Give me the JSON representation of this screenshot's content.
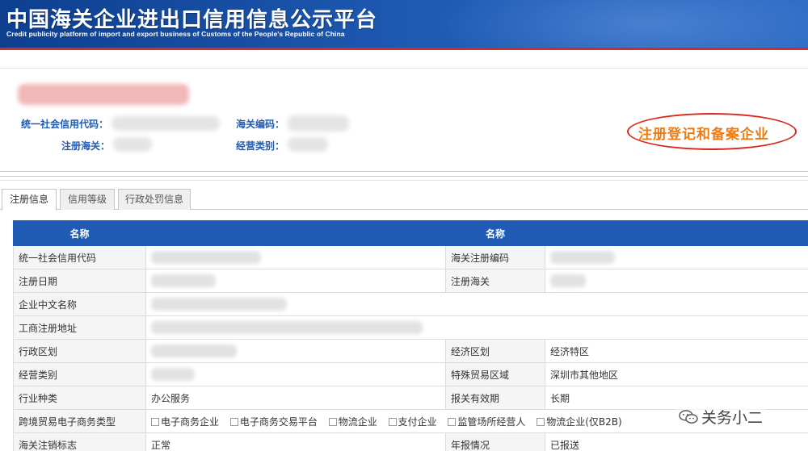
{
  "header": {
    "title": "中国海关企业进出口信用信息公示平台",
    "subtitle": "Credit publicity platform of import and export business of Customs of the People's Republic of China"
  },
  "company": {
    "labels": {
      "credit_code": "统一社会信用代码：",
      "customs_code": "海关编码：",
      "reg_customs": "注册海关：",
      "business_type": "经营类别："
    },
    "annotation": "注册登记和备案企业"
  },
  "tabs": [
    {
      "label": "注册信息",
      "active": true
    },
    {
      "label": "信用等级",
      "active": false
    },
    {
      "label": "行政处罚信息",
      "active": false
    }
  ],
  "table": {
    "headers": [
      "名称",
      "",
      "名称",
      ""
    ],
    "rows": {
      "r1": {
        "k1": "统一社会信用代码",
        "k2": "海关注册编码"
      },
      "r2": {
        "k1": "注册日期",
        "k2": "注册海关"
      },
      "r3": {
        "k1": "企业中文名称"
      },
      "r4": {
        "k1": "工商注册地址"
      },
      "r5": {
        "k1": "行政区划",
        "k2": "经济区划",
        "v2": "经济特区"
      },
      "r6": {
        "k1": "经营类别",
        "k2": "特殊贸易区域",
        "v2": "深圳市其他地区"
      },
      "r7": {
        "k1": "行业种类",
        "v1": "办公服务",
        "k2": "报关有效期",
        "v2": "长期"
      },
      "r8": {
        "k1": "跨境贸易电子商务类型",
        "options": [
          "电子商务企业",
          "电子商务交易平台",
          "物流企业",
          "支付企业",
          "监管场所经营人",
          "物流企业(仅B2B)"
        ]
      },
      "r9": {
        "k1": "海关注销标志",
        "v1": "正常",
        "k2": "年报情况",
        "v2": "已报送"
      }
    }
  },
  "watermark": "关务小二"
}
